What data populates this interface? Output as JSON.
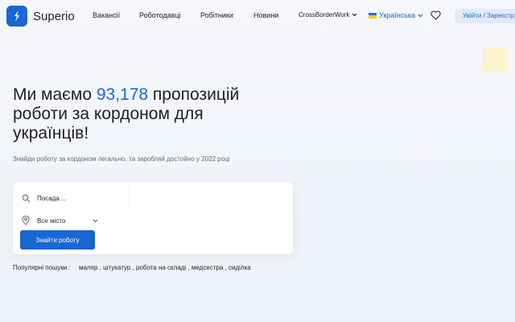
{
  "header": {
    "brand": "Superio",
    "nav": [
      "Вакансії",
      "Роботодавці",
      "Робітники",
      "Новини"
    ],
    "nav_dropdown": "CrossBorderWork",
    "language": "Українська",
    "login_label": "Увійти / Зареєстр"
  },
  "hero": {
    "title_before": "Ми маємо ",
    "title_count": "93,178",
    "title_after": " пропозицій роботи за кордоном для українців!",
    "subtitle": "Знайди роботу за кордоном легально, та заробляй достойно у 2022 році"
  },
  "search": {
    "keyword_placeholder": "Посада ...",
    "location_value": "Все місто",
    "submit_label": "Знайти роботу"
  },
  "popular": {
    "label": "Популярні пошуки :",
    "links": "маляр , штукатур , робота на складі , медсестра , сиділка"
  },
  "colors": {
    "accent": "#1967d2",
    "button_bg": "#1967d2",
    "login_bg": "#e2eaf8",
    "flag_blue": "#2d6fd1",
    "flag_yellow": "#f7d116"
  },
  "icons": {
    "logo": "logo-icon",
    "dropdown": "chevron-down-icon",
    "favorites": "heart-icon",
    "search": "search-icon",
    "location": "map-pin-icon"
  }
}
